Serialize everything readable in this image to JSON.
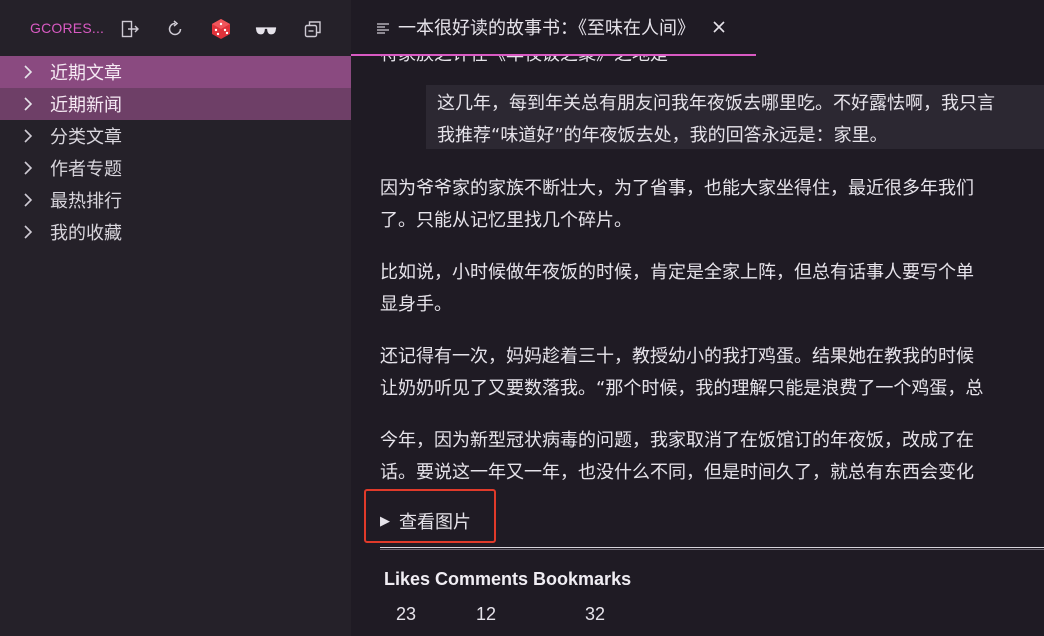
{
  "app": {
    "brand": "GCORES..."
  },
  "header_icons": [
    "logout-icon",
    "refresh-icon",
    "dice-icon",
    "glasses-icon",
    "collapse-all-icon"
  ],
  "sidebar": {
    "items": [
      {
        "label": "近期文章"
      },
      {
        "label": "近期新闻"
      },
      {
        "label": "分类文章"
      },
      {
        "label": "作者专题"
      },
      {
        "label": "最热排行"
      },
      {
        "label": "我的收藏"
      }
    ]
  },
  "tab": {
    "title": "一本很好读的故事书：《至味在人间》"
  },
  "article": {
    "cut_line": "特家族之许在《年夜饭之聚》之地是",
    "quote": [
      "这几年，每到年关总有朋友问我年夜饭去哪里吃。不好露怯啊，我只言",
      "我推荐“味道好”的年夜饭去处，我的回答永远是：家里。"
    ],
    "paragraphs": [
      [
        "因为爷爷家的家族不断壮大，为了省事，也能大家坐得住，最近很多年我们",
        "了。只能从记忆里找几个碎片。"
      ],
      [
        "比如说，小时候做年夜饭的时候，肯定是全家上阵，但总有话事人要写个单",
        "显身手。"
      ],
      [
        "还记得有一次，妈妈趁着三十，教授幼小的我打鸡蛋。结果她在教我的时候",
        "让奶奶听见了又要数落我。“那个时候，我的理解只能是浪费了一个鸡蛋，总"
      ],
      [
        "今年，因为新型冠状病毒的问题，我家取消了在饭馆订的年夜饭，改成了在",
        "话。要说这一年又一年，也没什么不同，但是时间久了，就总有东西会变化"
      ]
    ],
    "details_label": "查看图片"
  },
  "stats": {
    "header": "Likes Comments Bookmarks",
    "likes": "23",
    "comments": "12",
    "bookmarks": "32"
  },
  "colors": {
    "accent": "#d95ac3",
    "active_item": "#8a4a80",
    "highlight_box": "#e03a2a"
  }
}
